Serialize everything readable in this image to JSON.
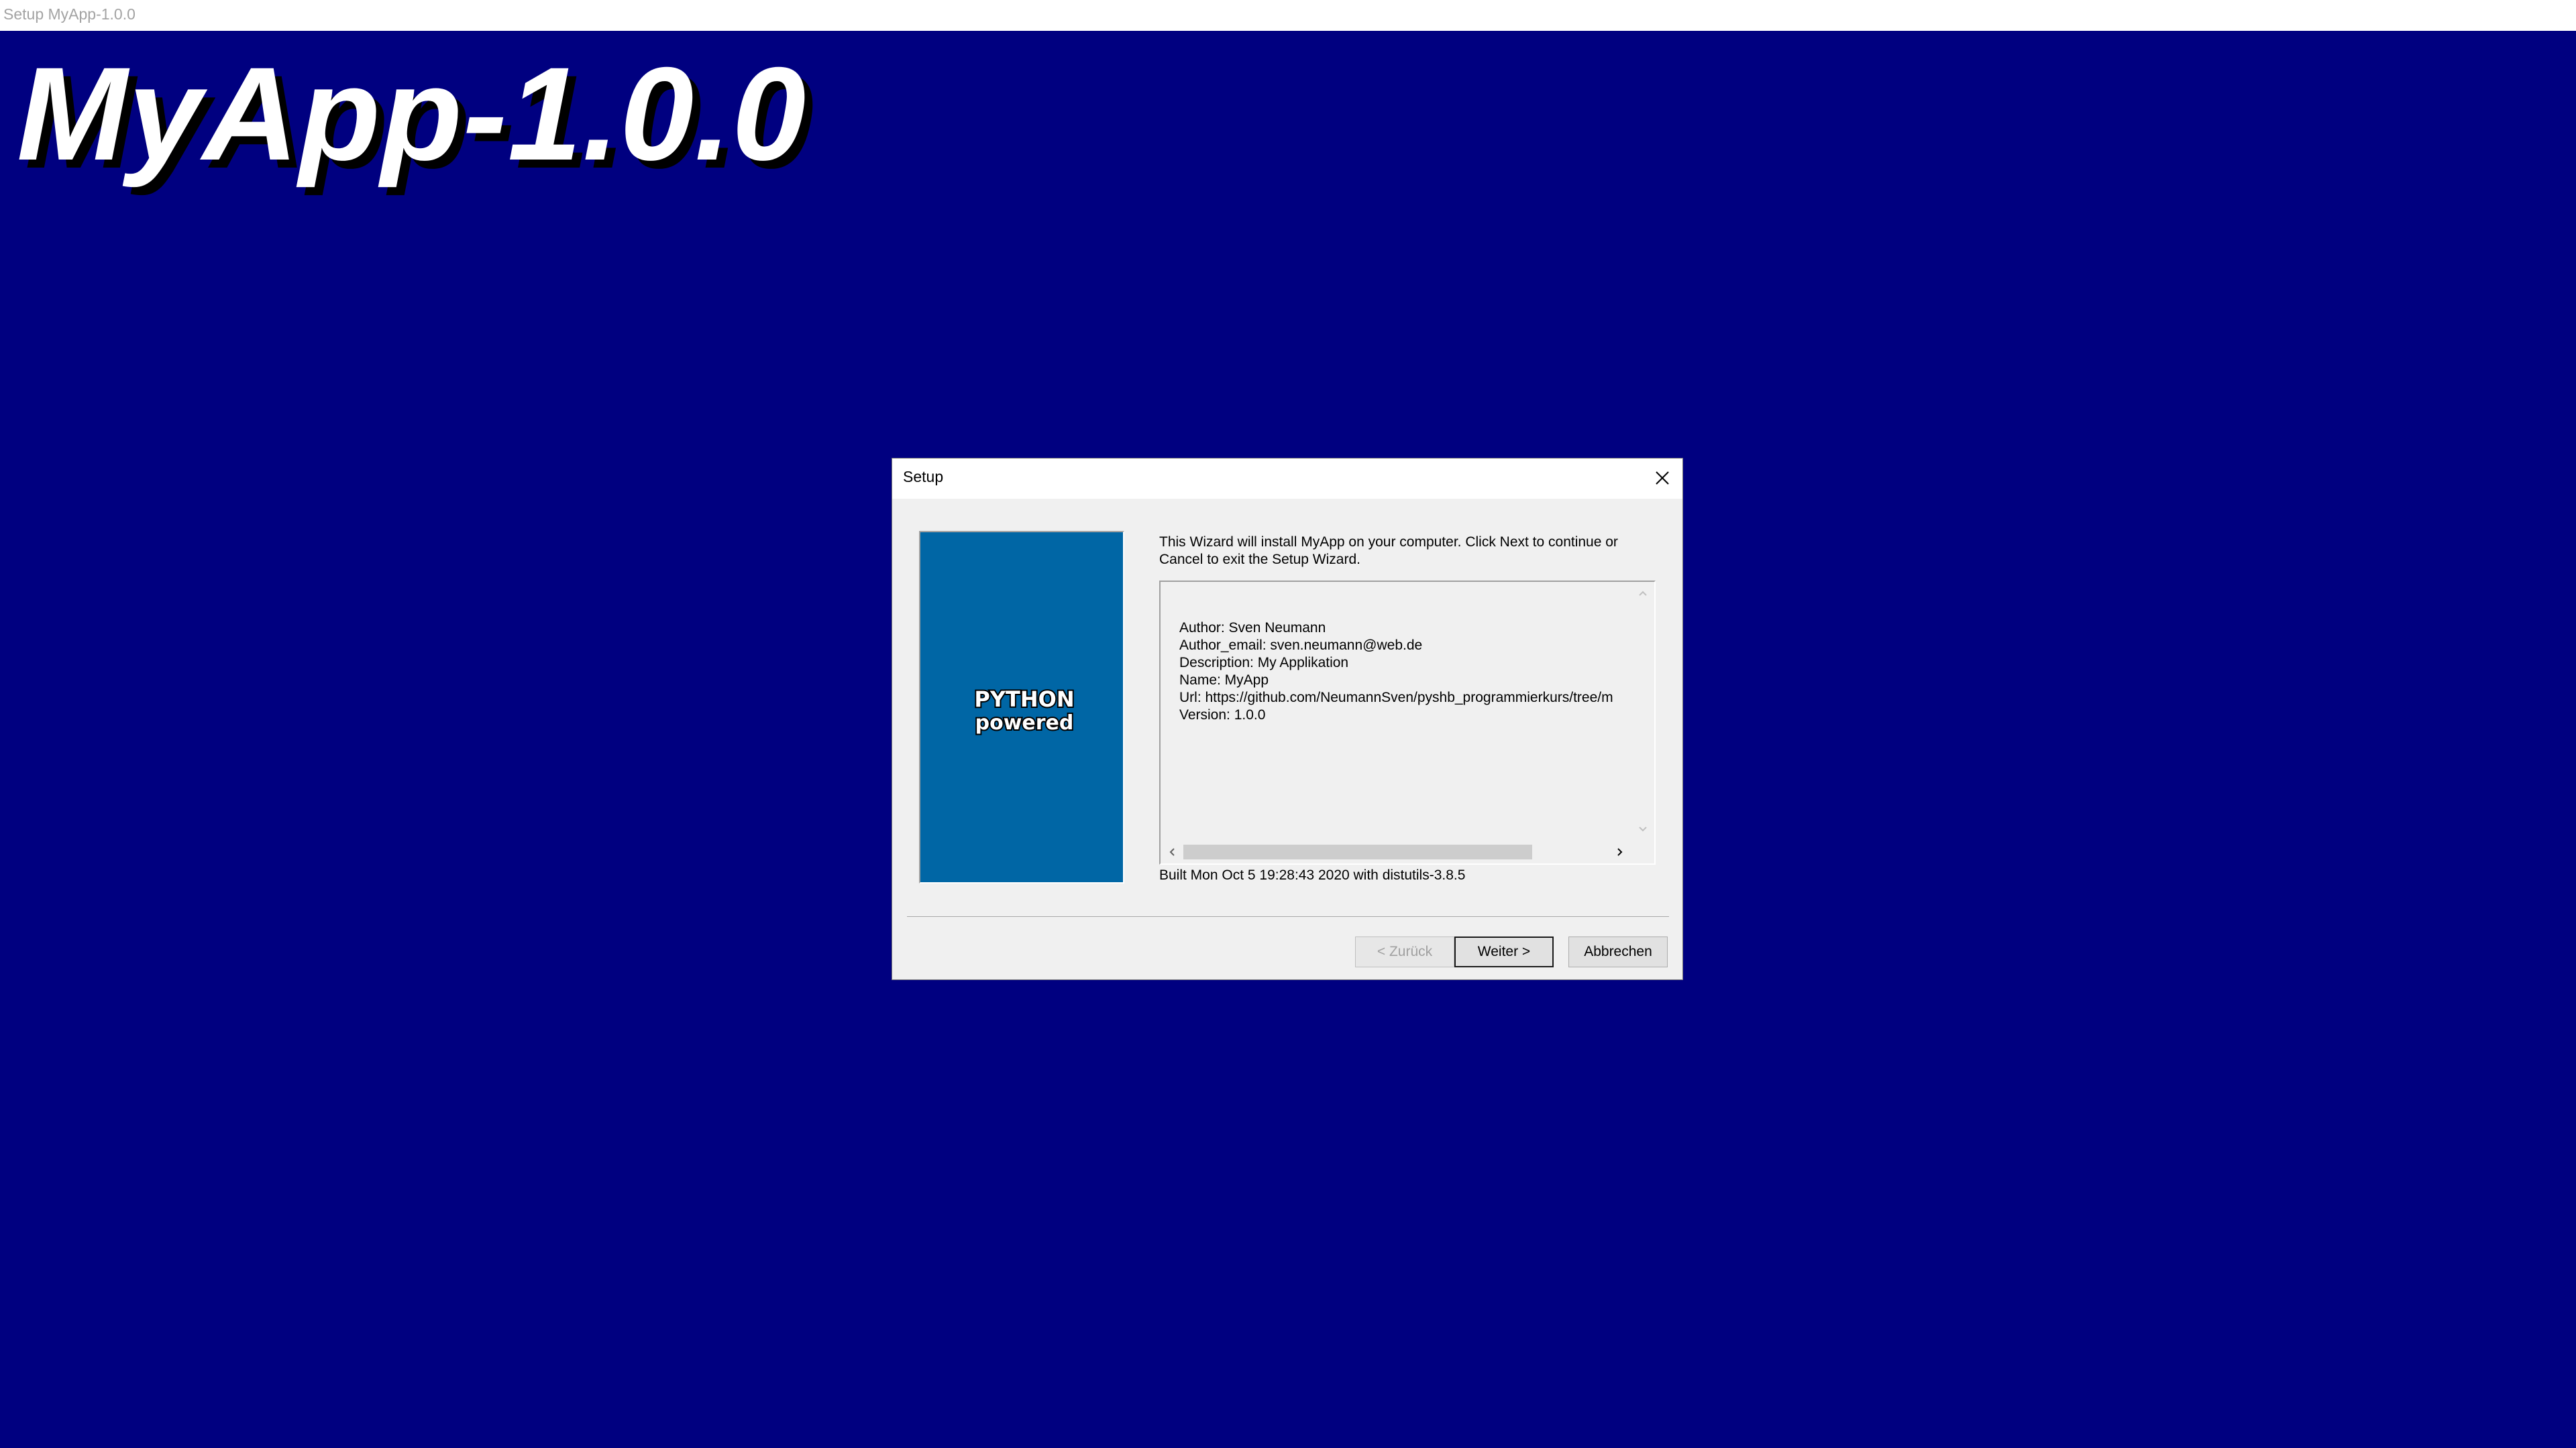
{
  "window": {
    "title": "Setup MyApp-1.0.0"
  },
  "backdrop": {
    "title": "MyApp-1.0.0",
    "color": "#000080"
  },
  "dialog": {
    "title": "Setup",
    "close_icon": "close-icon",
    "bitmap": {
      "background": "#0066a5",
      "logo_line1": "PYTHON",
      "logo_line2": "powered"
    },
    "intro_text": "This Wizard will install MyApp on your computer. Click Next to continue or Cancel to exit the Setup Wizard.",
    "info_lines": [
      "Author: Sven Neumann",
      "Author_email: sven.neumann@web.de",
      "Description: My Applikation",
      "Name: MyApp",
      "Url: https://github.com/NeumannSven/pyshb_programmierkurs/tree/m",
      "Version: 1.0.0"
    ],
    "built_text": "Built Mon Oct  5 19:28:43 2020 with distutils-3.8.5",
    "buttons": {
      "back": "< Zurück",
      "next": "Weiter >",
      "cancel": "Abbrechen"
    }
  }
}
